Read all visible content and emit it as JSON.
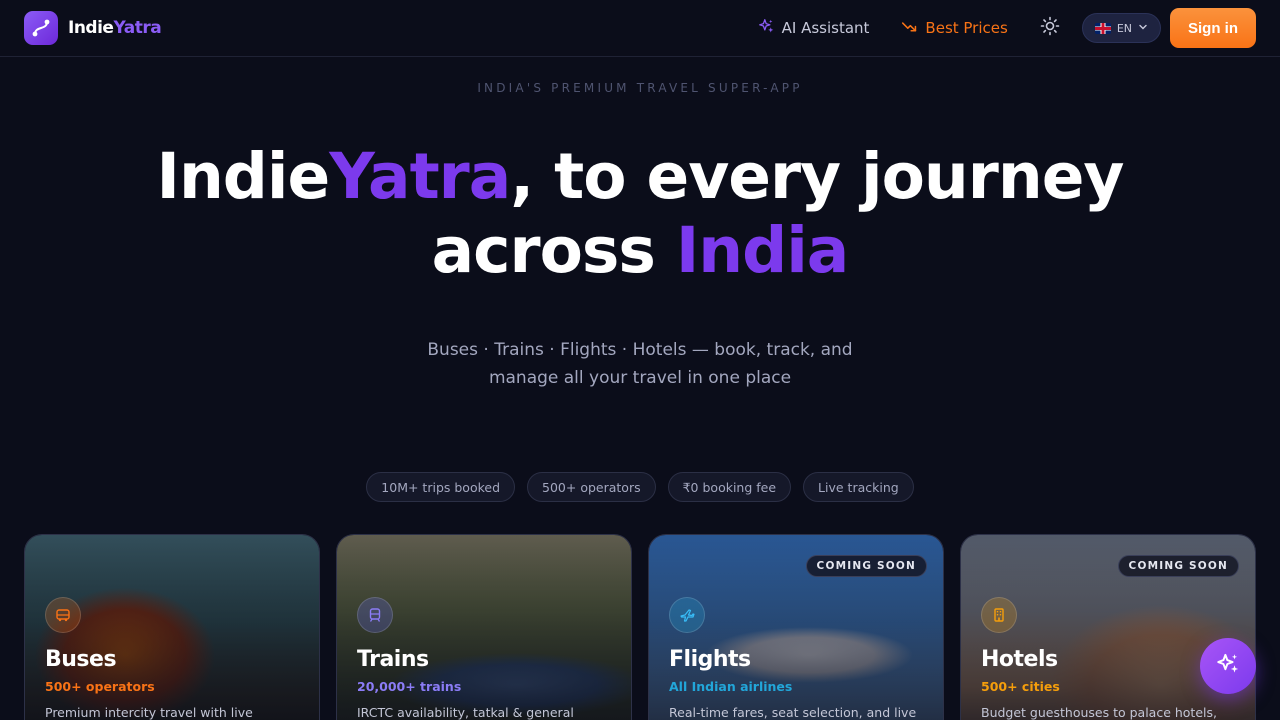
{
  "brand": {
    "name_part1": "Indie",
    "name_part2": "Yatra"
  },
  "nav": {
    "ai_assistant": "AI Assistant",
    "best_prices": "Best Prices",
    "language": "EN",
    "sign_in": "Sign in"
  },
  "hero": {
    "eyebrow": "INDIA'S PREMIUM TRAVEL SUPER-APP",
    "headline_accent1": "IndieYatra",
    "headline_part1_white": "Indie",
    "headline_part1_purple": "Yatra",
    "headline_part2": ", to every journey",
    "headline_part3": "across ",
    "headline_part4": "India",
    "subtitle": "Buses · Trains · Flights · Hotels — book, track, and manage all your travel in one place"
  },
  "stats_pills": [
    "10M+ trips booked",
    "500+ operators",
    "₹0 booking fee",
    "Live tracking"
  ],
  "cards": [
    {
      "title": "Buses",
      "stat": "500+ operators",
      "desc": "Premium intercity travel with live tracking",
      "badge": ""
    },
    {
      "title": "Trains",
      "stat": "20,000+ trains",
      "desc": "IRCTC availability, tatkal & general quotas,",
      "badge": ""
    },
    {
      "title": "Flights",
      "stat": "All Indian airlines",
      "desc": "Real-time fares, seat selection, and live",
      "badge": "COMING SOON"
    },
    {
      "title": "Hotels",
      "stat": "500+ cities",
      "desc": "Budget guesthouses to palace hotels,",
      "badge": "COMING SOON"
    }
  ],
  "colors": {
    "accent_purple": "#7c3aed",
    "accent_orange": "#f97316",
    "bus_stat": "#f97316",
    "train_stat": "#8b7cf6",
    "flight_stat": "#22a6d9",
    "hotel_stat": "#f59e0b",
    "background": "#0b0d1a"
  },
  "icons": {
    "ai": "sparkle-icon",
    "best_prices": "trending-down-icon",
    "theme": "sun-icon",
    "language_flag": "uk-flag-icon",
    "language_chevron": "chevron-down-icon",
    "fab": "sparkle-icon"
  }
}
